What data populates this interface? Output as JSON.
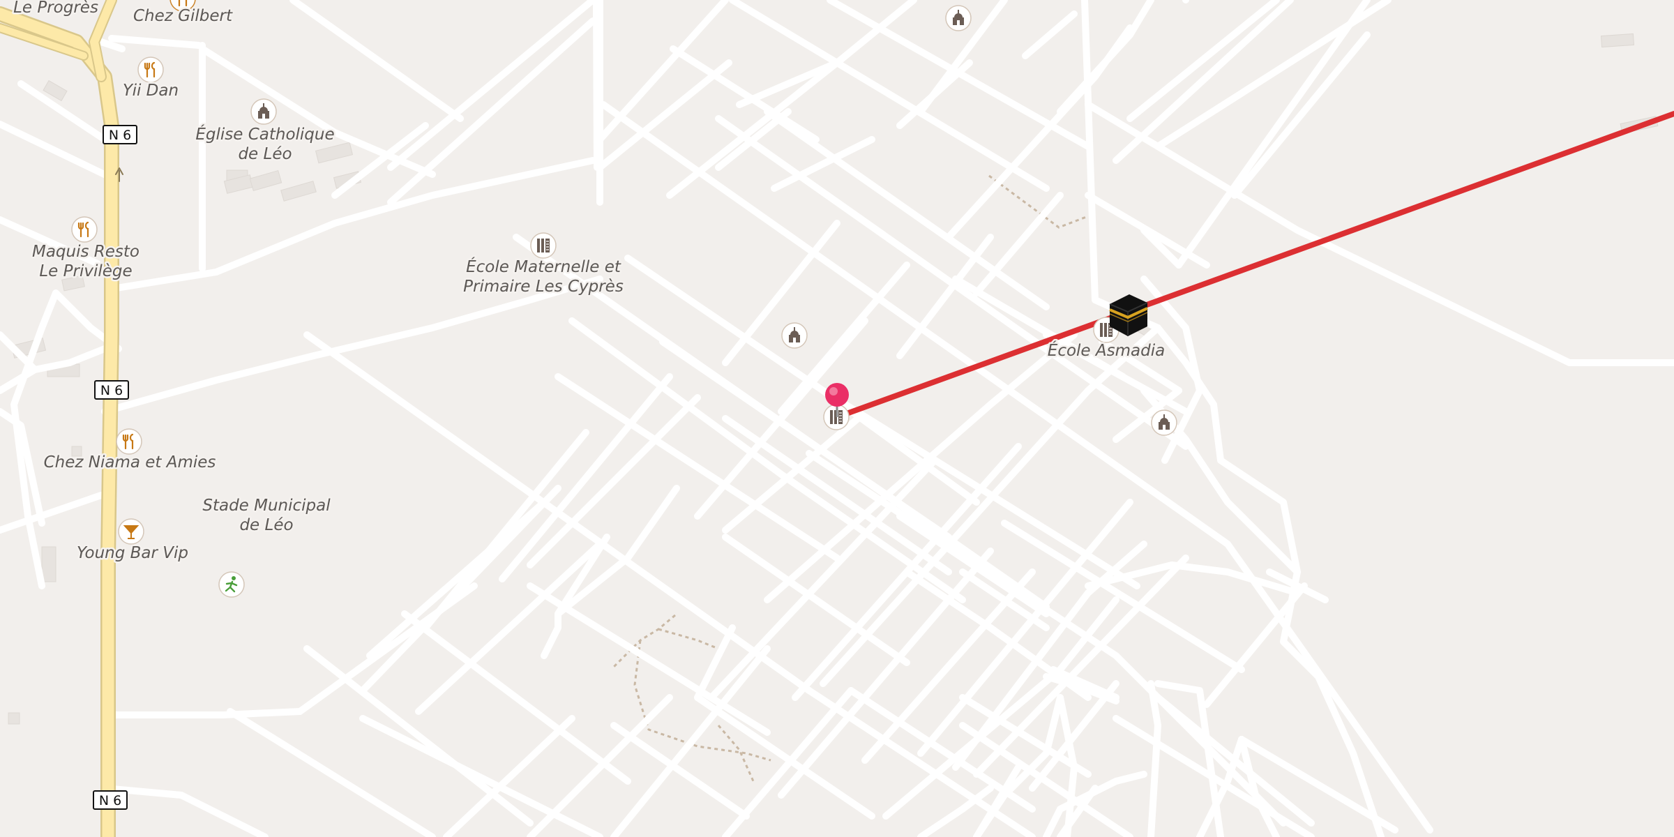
{
  "map": {
    "road_shield": "N 6",
    "labels": {
      "le_progres": "Le Progrès",
      "chez_gilbert": "Chez Gilbert",
      "yii_dan": "Yii Dan",
      "eglise_1": "Église Catholique",
      "eglise_2": "de Léo",
      "maquis_1": "Maquis Resto",
      "maquis_2": "Le Privilège",
      "ecole_mat_1": "École Maternelle et",
      "ecole_mat_2": "Primaire Les Cyprès",
      "ecole_asmadia": "École Asmadia",
      "chez_niama": "Chez Niama et Amies",
      "stade_1": "Stade Municipal",
      "stade_2": "de Léo",
      "young_bar": "Young Bar Vip"
    },
    "icons": [
      "restaurant-icon",
      "place-of-worship-icon",
      "school-icon",
      "bar-icon",
      "sports-icon",
      "kaaba-icon",
      "location-pin-icon"
    ],
    "colors": {
      "background": "#f2efec",
      "road": "#ffffff",
      "trunk_road": "#fde9a8",
      "qibla_line": "#dc2f32",
      "pin": "#ea2f66",
      "food_icon": "#c77814",
      "worship_icon": "#6b5d55",
      "sports_icon": "#4a9e3a"
    }
  }
}
